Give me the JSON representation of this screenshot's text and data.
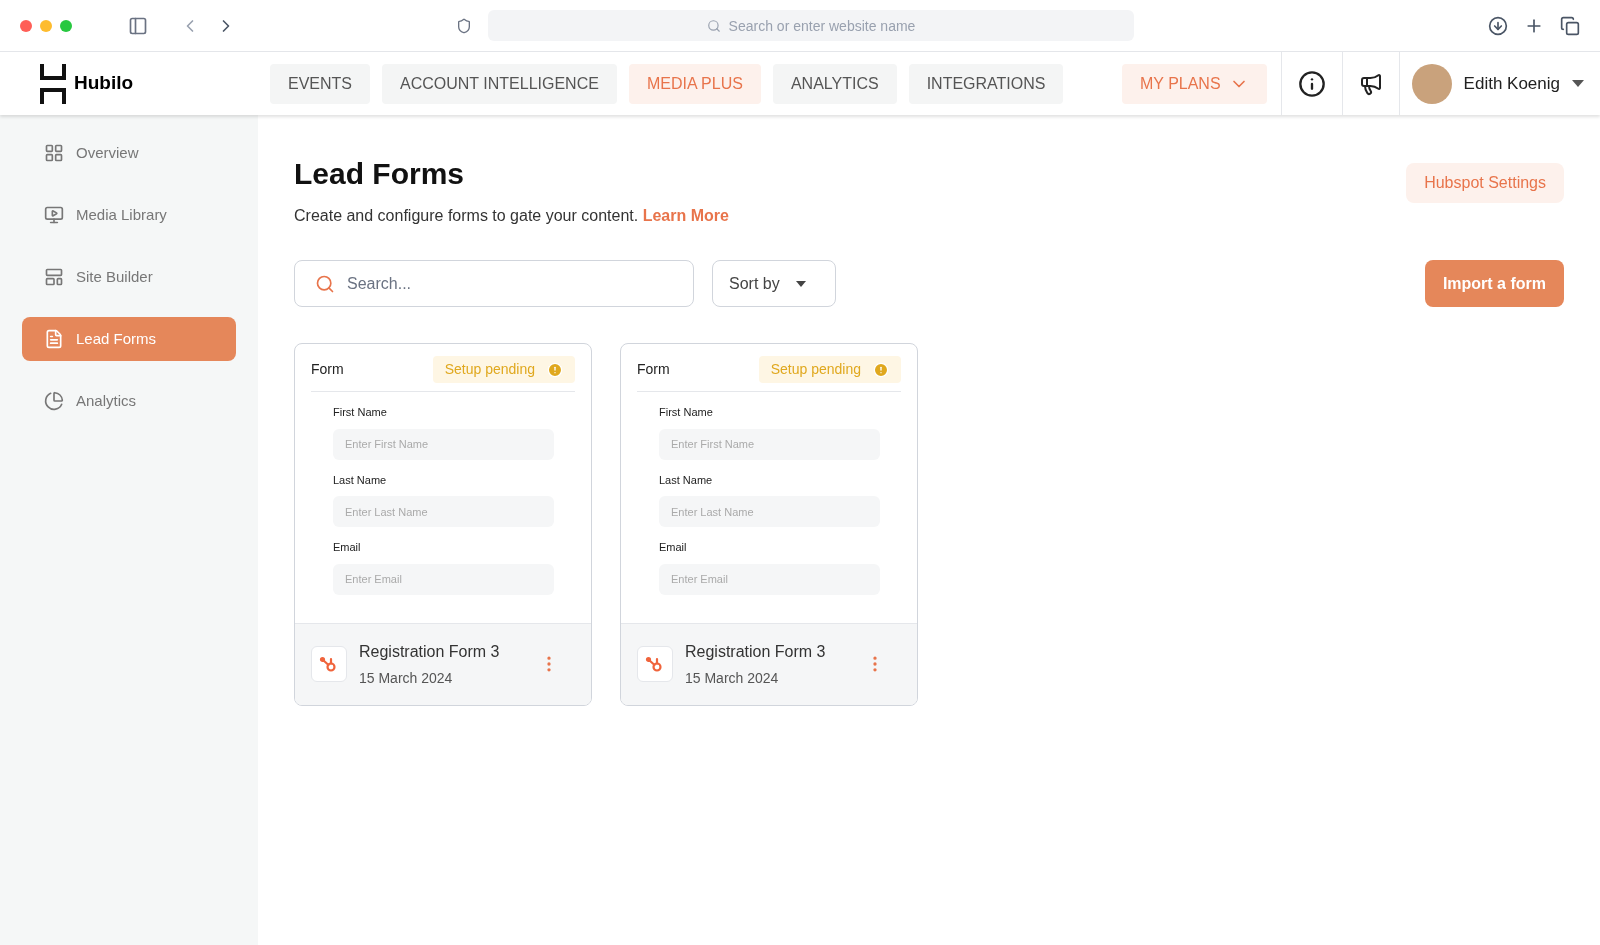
{
  "browser": {
    "address_placeholder": "Search or enter website name"
  },
  "header": {
    "logo": "Hubilo",
    "tabs": [
      {
        "label": "EVENTS",
        "selected": false
      },
      {
        "label": "ACCOUNT INTELLIGENCE",
        "selected": false
      },
      {
        "label": "MEDIA PLUS",
        "selected": true
      },
      {
        "label": "ANALYTICS",
        "selected": false
      },
      {
        "label": "INTEGRATIONS",
        "selected": false
      }
    ],
    "plans": "MY PLANS",
    "user": "Edith Koenig"
  },
  "sidebar": {
    "items": [
      {
        "label": "Overview",
        "selected": false
      },
      {
        "label": "Media Library",
        "selected": false
      },
      {
        "label": "Site Builder",
        "selected": false
      },
      {
        "label": "Lead Forms",
        "selected": true
      },
      {
        "label": "Analytics",
        "selected": false
      }
    ]
  },
  "page": {
    "title": "Lead Forms",
    "subtitle": "Create and configure forms to gate your content.",
    "link": "Learn More",
    "settings_button": "Hubspot Settings",
    "search_placeholder": "Search...",
    "sort": "Sort by",
    "import_button": "Import a form"
  },
  "forms": [
    {
      "header": "Form",
      "status": "Setup pending",
      "fields": [
        {
          "label": "First Name",
          "placeholder": "Enter First Name"
        },
        {
          "label": "Last Name",
          "placeholder": "Enter Last Name"
        },
        {
          "label": "Email",
          "placeholder": "Enter Email"
        }
      ],
      "name": "Registration Form 3",
      "date": "15 March 2024"
    },
    {
      "header": "Form",
      "status": "Setup pending",
      "fields": [
        {
          "label": "First Name",
          "placeholder": "Enter First Name"
        },
        {
          "label": "Last Name",
          "placeholder": "Enter Last Name"
        },
        {
          "label": "Email",
          "placeholder": "Enter Email"
        }
      ],
      "name": "Registration Form 3",
      "date": "15 March 2024"
    }
  ]
}
